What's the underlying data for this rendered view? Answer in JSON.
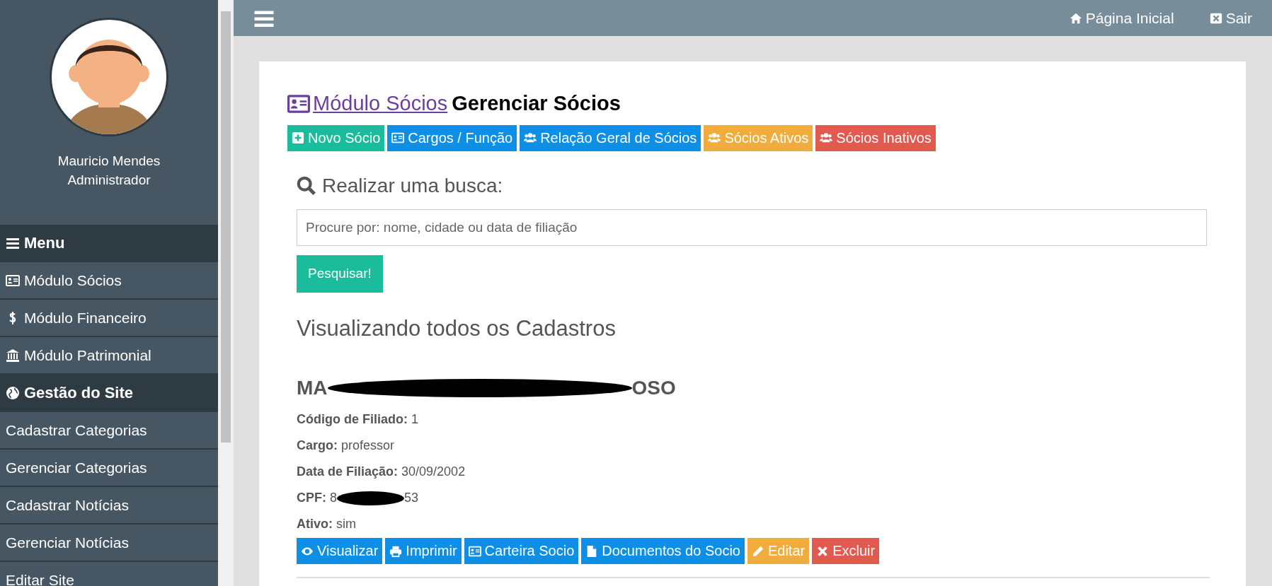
{
  "profile": {
    "kind": "picture",
    "name": "Mauricio Mendes",
    "role": "Administrador"
  },
  "sidebar": {
    "sections": [
      {
        "header": {
          "kind": "menu",
          "label": "Menu"
        },
        "items": [
          {
            "kind": "card",
            "label": "Módulo Sócios"
          },
          {
            "kind": "dollar",
            "label": "Módulo Financeiro"
          },
          {
            "kind": "bank",
            "label": "Módulo Patrimonial"
          }
        ]
      },
      {
        "header": {
          "kind": "globe",
          "label": "Gestão do Site"
        },
        "items": [
          {
            "kind": "text",
            "label": "Cadastrar Categorias"
          },
          {
            "kind": "text",
            "label": "Gerenciar Categorias"
          },
          {
            "kind": "text",
            "label": "Cadastrar Notícias"
          },
          {
            "kind": "text",
            "label": "Gerenciar Notícias"
          },
          {
            "kind": "text",
            "label": "Editar Site"
          }
        ]
      }
    ]
  },
  "topbar": {
    "links": [
      {
        "kind": "home",
        "label": "Página Inicial"
      },
      {
        "kind": "close",
        "label": "Sair"
      }
    ]
  },
  "page": {
    "breadcrumb": "Módulo Sócios",
    "title": "Gerenciar Sócios",
    "actions": [
      {
        "kind": "plus",
        "label": "Novo Sócio",
        "color": "#1abc9c"
      },
      {
        "kind": "card",
        "label": "Cargos / Função",
        "color": "#0d8fe6"
      },
      {
        "kind": "users",
        "label": "Relação Geral de Sócios",
        "color": "#0d8fe6"
      },
      {
        "kind": "users",
        "label": "Sócios Ativos",
        "color": "#f0ad3e"
      },
      {
        "kind": "users",
        "label": "Sócios Inativos",
        "color": "#e05a4f"
      }
    ],
    "search": {
      "heading": "Realizar uma busca:",
      "placeholder": "Procure por: nome, cidade ou data de filiação",
      "button": "Pesquisar!"
    },
    "listing_heading": "Visualizando todos os Cadastros",
    "records": [
      {
        "name_start": "MA",
        "name_end": "OSO",
        "fields": [
          {
            "label": "Código de Filiado:",
            "value": "1"
          },
          {
            "label": "Cargo:",
            "value": "professor"
          },
          {
            "label": "Data de Filiação:",
            "value": "30/09/2002"
          },
          {
            "label": "CPF:",
            "value": "8",
            "value_end": "53"
          },
          {
            "label": "Ativo:",
            "value": "sim"
          }
        ],
        "buttons": [
          {
            "kind": "eye",
            "label": "Visualizar",
            "color": "#0d8fe6"
          },
          {
            "kind": "print",
            "label": "Imprimir",
            "color": "#0d8fe6"
          },
          {
            "kind": "card",
            "label": "Carteira Socio",
            "color": "#0d8fe6"
          },
          {
            "kind": "file",
            "label": "Documentos do Socio",
            "color": "#0d8fe6"
          },
          {
            "kind": "pencil",
            "label": "Editar",
            "color": "#f0ad3e"
          },
          {
            "kind": "times",
            "label": "Excluir",
            "color": "#e05a4f"
          }
        ]
      }
    ]
  }
}
